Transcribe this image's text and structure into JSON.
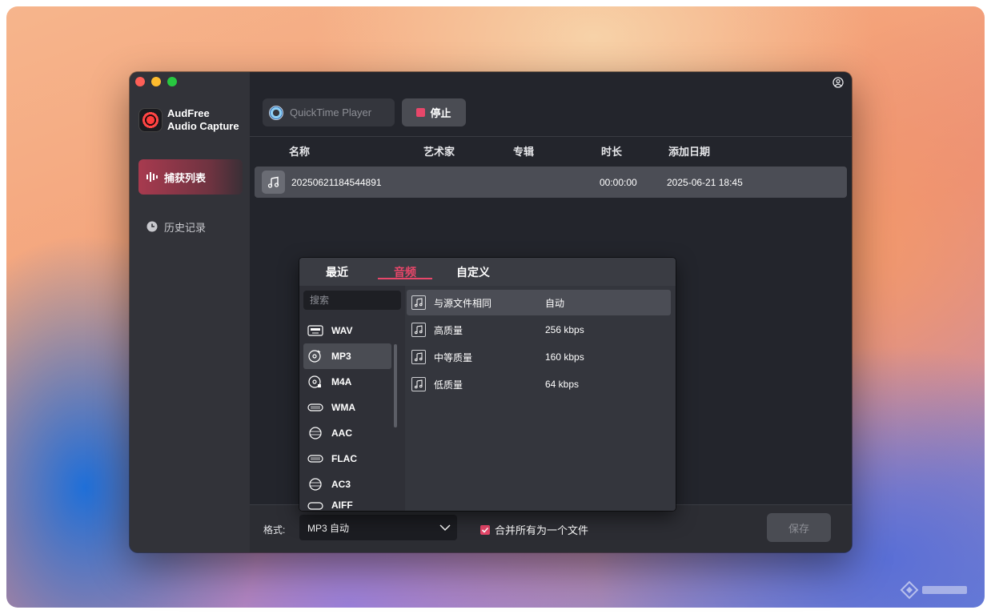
{
  "app": {
    "name_line1": "AudFree",
    "name_line2": "Audio Capture"
  },
  "sidebar": {
    "items": [
      {
        "label": "捕获列表",
        "icon": "waveform-icon"
      },
      {
        "label": "历史记录",
        "icon": "clock-icon"
      }
    ]
  },
  "toolbar": {
    "source_label": "QuickTime Player",
    "stop_label": "停止"
  },
  "table": {
    "headers": [
      "名称",
      "艺术家",
      "专辑",
      "时长",
      "添加日期"
    ],
    "rows": [
      {
        "name": "20250621184544891",
        "artist": "",
        "album": "",
        "duration": "00:00:00",
        "date": "2025-06-21 18:45"
      }
    ]
  },
  "popup": {
    "tabs": [
      "最近",
      "音频",
      "自定义"
    ],
    "active_tab": "音频",
    "search_placeholder": "搜索",
    "formats": [
      "WAV",
      "MP3",
      "M4A",
      "WMA",
      "AAC",
      "FLAC",
      "AC3",
      "AIFF"
    ],
    "selected_format": "MP3",
    "qualities": [
      {
        "name": "与源文件相同",
        "bitrate": "自动"
      },
      {
        "name": "高质量",
        "bitrate": "256 kbps"
      },
      {
        "name": "中等质量",
        "bitrate": "160 kbps"
      },
      {
        "name": "低质量",
        "bitrate": "64 kbps"
      }
    ]
  },
  "footer": {
    "format_label": "格式:",
    "format_value": "MP3 自动",
    "merge_label": "合并所有为一个文件",
    "merge_checked": true,
    "save_label": "保存"
  },
  "colors": {
    "accent": "#e8476a",
    "window_bg": "#23252c",
    "sidebar_bg": "#323339"
  }
}
